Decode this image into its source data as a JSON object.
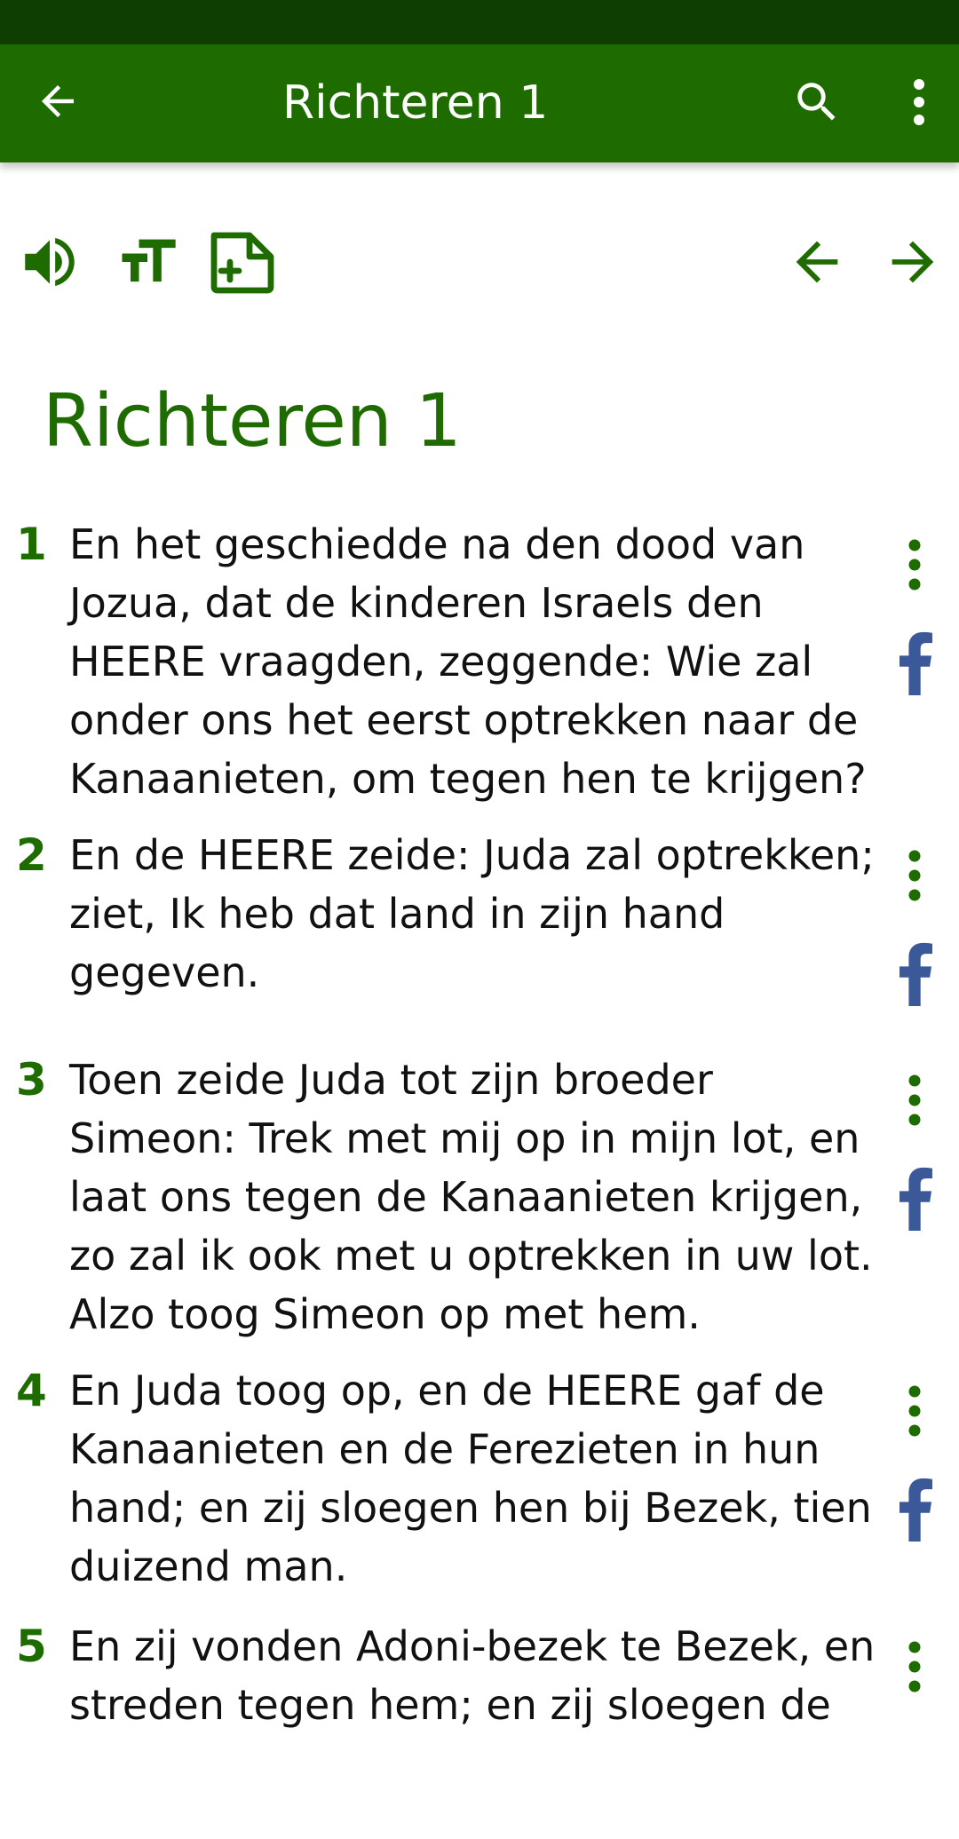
{
  "app_bar": {
    "title": "Richteren 1",
    "back_icon": "arrow-left-icon",
    "search_icon": "search-icon",
    "more_icon": "more-vert-icon"
  },
  "toolbar": {
    "audio_icon": "speaker-icon",
    "text_size_icon": "text-size-icon",
    "add_note_icon": "add-note-icon",
    "prev_icon": "arrow-left-icon",
    "next_icon": "arrow-right-icon"
  },
  "chapter": {
    "title": "Richteren 1"
  },
  "verses": [
    {
      "number": "1",
      "text": "En het geschiedde na den dood van Jozua, dat de kinderen Israels den HEERE vraagden, zeggende: Wie zal onder ons het eerst optrekken naar de Kanaanieten, om tegen hen te krijgen?"
    },
    {
      "number": "2",
      "text": "En de HEERE zeide: Juda zal optrekken; ziet, Ik heb dat land in zijn hand gegeven."
    },
    {
      "number": "3",
      "text": "Toen zeide Juda tot zijn broeder Simeon: Trek met mij op in mijn lot, en laat ons tegen de Kanaanieten krijgen, zo zal ik ook met u optrekken in uw lot. Alzo toog Simeon op met hem."
    },
    {
      "number": "4",
      "text": "En Juda toog op, en de HEERE gaf de Kanaanieten en de Ferezieten in hun hand; en zij sloegen hen bij Bezek, tien duizend man."
    },
    {
      "number": "5",
      "text": "En zij vonden Adoni-bezek te Bezek, en streden tegen hem; en zij sloegen de"
    }
  ],
  "colors": {
    "status_bar": "#0f3f00",
    "app_bar": "#1e6b00",
    "accent": "#1e6b00",
    "facebook": "#3b5998"
  }
}
